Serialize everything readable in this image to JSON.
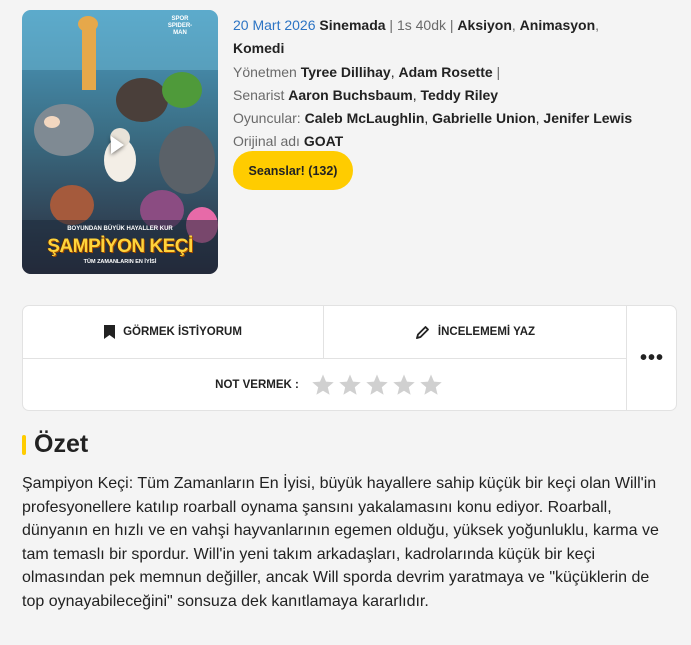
{
  "poster": {
    "badge": "SPOR SPIDER-MAN",
    "tagline": "BOYUNDAN BÜYÜK HAYALLER KUR",
    "title": "ŞAMPİYON KEÇİ",
    "subtitle": "TÜM ZAMANLARIN EN İYİSİ"
  },
  "movie": {
    "release_date": "20 Mart 2026",
    "release_where": "Sinemada",
    "duration": "1s 40dk",
    "genres": [
      "Aksiyon",
      "Animasyon",
      "Komedi"
    ],
    "director_label": "Yönetmen",
    "directors": [
      "Tyree Dillihay",
      "Adam Rosette"
    ],
    "writer_label": "Senarist",
    "writers": [
      "Aaron Buchsbaum",
      "Teddy Riley"
    ],
    "cast_label": "Oyuncular:",
    "cast": [
      "Caleb McLaughlin",
      "Gabrielle Union",
      "Jenifer Lewis"
    ],
    "original_title_label": "Orijinal adı",
    "original_title": "GOAT"
  },
  "sessions_button": "Seanslar! (132)",
  "actions": {
    "watchlist": "GÖRMEK İSTİYORUM",
    "review": "İNCELEMEMİ YAZ",
    "more": "•••",
    "rate_label": "NOT VERMEK :",
    "rating_value": 0,
    "rating_max": 5
  },
  "summary": {
    "heading": "Özet",
    "text": "Şampiyon Keçi: Tüm Zamanların En İyisi, büyük hayallere sahip küçük bir keçi olan Will'in profesyonellere katılıp roarball oynama şansını yakalamasını konu ediyor. Roarball, dünyanın en hızlı ve en vahşi hayvanlarının egemen olduğu, yüksek yoğunluklu, karma ve tam temaslı bir spordur. Will'in yeni takım arkadaşları, kadrolarında küçük bir keçi olmasından pek memnun değiller, ancak Will sporda devrim yaratmaya ve \"küçüklerin de top oynayabileceğini\" sonsuza dek kanıtlamaya kararlıdır."
  },
  "colors": {
    "accent": "#ffcc00",
    "date": "#2c74c4",
    "star": "#d0d0d0"
  }
}
